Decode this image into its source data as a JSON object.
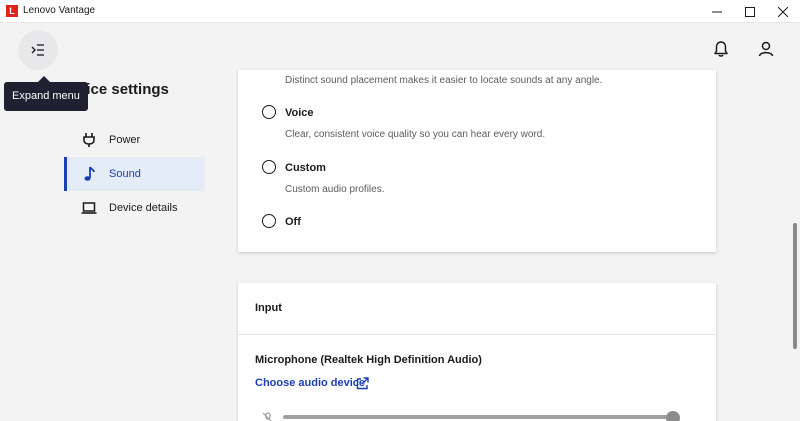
{
  "window": {
    "title": "Lenovo Vantage",
    "logo_letter": "L"
  },
  "header": {
    "tooltip": "Expand menu"
  },
  "sidebar": {
    "title": "vice settings",
    "items": [
      {
        "label": "Power",
        "icon": "power-plug-icon"
      },
      {
        "label": "Sound",
        "icon": "music-note-icon",
        "selected": true
      },
      {
        "label": "Device details",
        "icon": "laptop-icon"
      }
    ]
  },
  "sound_modes": {
    "cut_description": "Distinct sound placement makes it easier to locate sounds at any angle.",
    "options": [
      {
        "label": "Voice",
        "description": "Clear, consistent voice quality so you can hear every word."
      },
      {
        "label": "Custom",
        "description": "Custom audio profiles."
      },
      {
        "label": "Off",
        "description": ""
      }
    ]
  },
  "input": {
    "title": "Input",
    "device_name": "Microphone (Realtek High Definition Audio)",
    "choose_link": "Choose audio device",
    "volume_fraction": 0.99
  },
  "colors": {
    "accent": "#1a3fb5",
    "brand": "#e2231a",
    "tooltip_bg": "#1f2130"
  }
}
